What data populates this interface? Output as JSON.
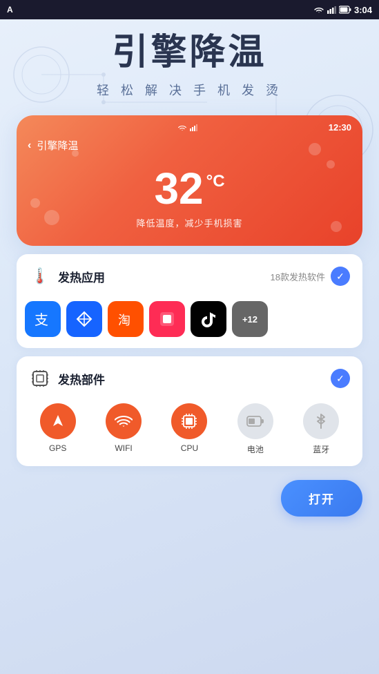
{
  "statusBar": {
    "time": "3:04",
    "appLabel": "A"
  },
  "hero": {
    "title": "引擎降温",
    "subtitle": "轻 松 解 决 手 机 发 烫"
  },
  "phoneMockup": {
    "time": "12:30",
    "backLabel": "引擎降温",
    "temperature": "32",
    "tempUnit": "°C",
    "tempDesc": "降低温度，减少手机损害"
  },
  "heatApps": {
    "title": "发热应用",
    "badge": "18款发热软件",
    "apps": [
      {
        "name": "alipay",
        "emoji": "🔵",
        "bg": "#1677FF"
      },
      {
        "name": "feishu",
        "emoji": "✈",
        "bg": "#006EFF"
      },
      {
        "name": "taobao",
        "emoji": "🛒",
        "bg": "#FF5500"
      },
      {
        "name": "douyin1",
        "emoji": "🔲",
        "bg": "#FE2C55"
      },
      {
        "name": "tiktok",
        "emoji": "♪",
        "bg": "#010101"
      }
    ],
    "moreLabel": "+12"
  },
  "heatComponents": {
    "title": "发热部件",
    "components": [
      {
        "name": "GPS",
        "label": "GPS",
        "icon": "⬆",
        "active": true
      },
      {
        "name": "WIFI",
        "label": "WIFI",
        "icon": "📶",
        "active": true
      },
      {
        "name": "CPU",
        "label": "CPU",
        "icon": "⬛",
        "active": true
      },
      {
        "name": "battery",
        "label": "电池",
        "icon": "🔋",
        "active": false
      },
      {
        "name": "bluetooth",
        "label": "蓝牙",
        "icon": "⚡",
        "active": false
      }
    ]
  },
  "openButton": {
    "label": "打开"
  }
}
